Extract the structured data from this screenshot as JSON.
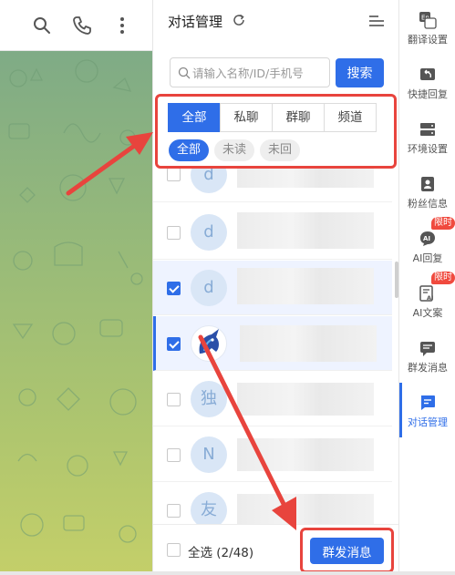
{
  "panel": {
    "title": "对话管理",
    "search_placeholder": "请输入名称/ID/手机号",
    "search_button": "搜索",
    "tabs": [
      {
        "label": "全部",
        "active": true
      },
      {
        "label": "私聊",
        "active": false
      },
      {
        "label": "群聊",
        "active": false
      },
      {
        "label": "频道",
        "active": false
      }
    ],
    "pills": [
      {
        "label": "全部",
        "active": true
      },
      {
        "label": "未读",
        "active": false
      },
      {
        "label": "未回",
        "active": false
      }
    ],
    "rows": [
      {
        "avatar": "d",
        "checked": false
      },
      {
        "avatar": "d",
        "checked": false
      },
      {
        "avatar": "d",
        "checked": true
      },
      {
        "avatar": "",
        "checked": true
      },
      {
        "avatar": "独",
        "checked": false
      },
      {
        "avatar": "N",
        "checked": false
      },
      {
        "avatar": "友",
        "checked": false
      }
    ],
    "select_all": "全选 (2/48)",
    "broadcast_button": "群发消息"
  },
  "sidebar": {
    "items": [
      {
        "label": "翻译设置",
        "icon": "translate-icon",
        "badge": ""
      },
      {
        "label": "快捷回复",
        "icon": "quick-reply-icon",
        "badge": ""
      },
      {
        "label": "环境设置",
        "icon": "environment-icon",
        "badge": ""
      },
      {
        "label": "粉丝信息",
        "icon": "fan-info-icon",
        "badge": ""
      },
      {
        "label": "AI回复",
        "icon": "ai-reply-icon",
        "badge": "限时"
      },
      {
        "label": "AI文案",
        "icon": "ai-copy-icon",
        "badge": "限时"
      },
      {
        "label": "群发消息",
        "icon": "broadcast-icon",
        "badge": ""
      },
      {
        "label": "对话管理",
        "icon": "chat-manage-icon",
        "badge": ""
      }
    ]
  },
  "colors": {
    "accent": "#2f6ee8",
    "highlight": "#e8443d",
    "badge": "#f04a3e",
    "chat_bg_top": "#7fab86",
    "chat_bg_bottom": "#c4cf69"
  }
}
